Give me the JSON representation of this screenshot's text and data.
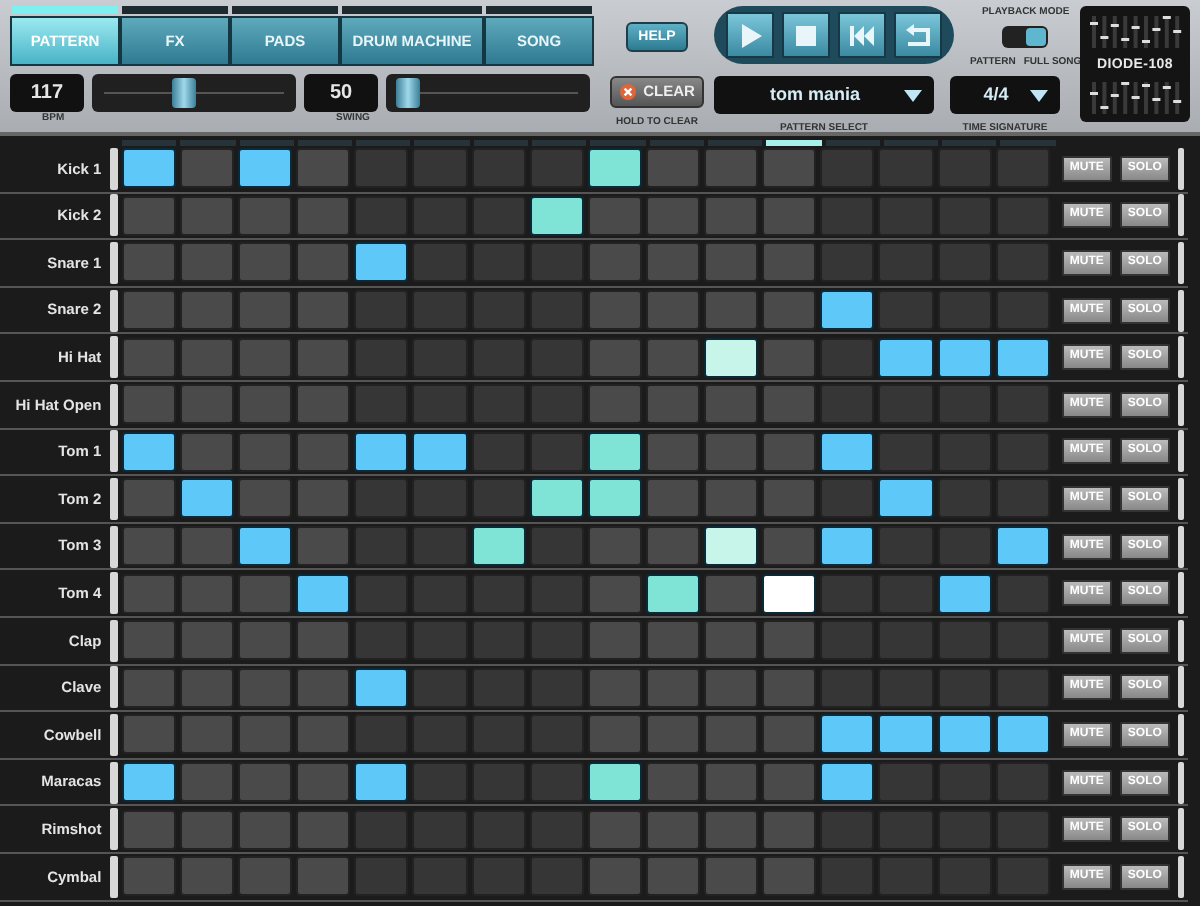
{
  "tabs": [
    {
      "label": "PATTERN",
      "selected": true
    },
    {
      "label": "FX",
      "selected": false
    },
    {
      "label": "PADS",
      "selected": false
    },
    {
      "label": "DRUM MACHINE",
      "selected": false
    },
    {
      "label": "SONG",
      "selected": false
    }
  ],
  "bpm": {
    "value": "117",
    "label": "BPM",
    "level": 0.45
  },
  "swing": {
    "value": "50",
    "label": "SWING",
    "level": 0.05
  },
  "help_button": "HELP",
  "transport": [
    {
      "kind": "play"
    },
    {
      "kind": "stop"
    },
    {
      "kind": "rewind"
    },
    {
      "kind": "loop"
    }
  ],
  "playback_mode": {
    "title": "PLAYBACK MODE",
    "left_label": "PATTERN",
    "right_label": "FULL SONG",
    "full_song": true
  },
  "clear_button": {
    "label": "CLEAR",
    "hint": "HOLD TO CLEAR"
  },
  "pattern_select": {
    "value": "tom mania",
    "label": "PATTERN SELECT"
  },
  "time_signature": {
    "value": "4/4",
    "label": "TIME SIGNATURE"
  },
  "logo": "DIODE-108",
  "step_markers": [
    {
      "current": false
    },
    {
      "current": false
    },
    {
      "current": false
    },
    {
      "current": false
    },
    {
      "current": false
    },
    {
      "current": false
    },
    {
      "current": false
    },
    {
      "current": false
    },
    {
      "current": false
    },
    {
      "current": false
    },
    {
      "current": false
    },
    {
      "current": true
    },
    {
      "current": false
    },
    {
      "current": false
    },
    {
      "current": false
    },
    {
      "current": false
    }
  ],
  "tracks": [
    {
      "name": "Kick 1",
      "mute": "MUTE",
      "solo": "SOLO",
      "muted": false,
      "soloed": false,
      "steps": [
        {
          "on": true,
          "color": "#5ec8f8"
        },
        {
          "on": false
        },
        {
          "on": true,
          "color": "#5ec8f8"
        },
        {
          "on": false
        },
        {
          "on": false
        },
        {
          "on": false
        },
        {
          "on": false
        },
        {
          "on": false
        },
        {
          "on": true,
          "color": "#7fe3d6"
        },
        {
          "on": false
        },
        {
          "on": false
        },
        {
          "on": false
        },
        {
          "on": false
        },
        {
          "on": false
        },
        {
          "on": false
        },
        {
          "on": false
        }
      ]
    },
    {
      "name": "Kick 2",
      "mute": "MUTE",
      "solo": "SOLO",
      "muted": false,
      "soloed": false,
      "steps": [
        {
          "on": false
        },
        {
          "on": false
        },
        {
          "on": false
        },
        {
          "on": false
        },
        {
          "on": false
        },
        {
          "on": false
        },
        {
          "on": false
        },
        {
          "on": true,
          "color": "#7fe3d6"
        },
        {
          "on": false
        },
        {
          "on": false
        },
        {
          "on": false
        },
        {
          "on": false
        },
        {
          "on": false
        },
        {
          "on": false
        },
        {
          "on": false
        },
        {
          "on": false
        }
      ]
    },
    {
      "name": "Snare 1",
      "mute": "MUTE",
      "solo": "SOLO",
      "muted": false,
      "soloed": false,
      "steps": [
        {
          "on": false
        },
        {
          "on": false
        },
        {
          "on": false
        },
        {
          "on": false
        },
        {
          "on": true,
          "color": "#5ec8f8"
        },
        {
          "on": false
        },
        {
          "on": false
        },
        {
          "on": false
        },
        {
          "on": false
        },
        {
          "on": false
        },
        {
          "on": false
        },
        {
          "on": false
        },
        {
          "on": false
        },
        {
          "on": false
        },
        {
          "on": false
        },
        {
          "on": false
        }
      ]
    },
    {
      "name": "Snare 2",
      "mute": "MUTE",
      "solo": "SOLO",
      "muted": false,
      "soloed": false,
      "steps": [
        {
          "on": false
        },
        {
          "on": false
        },
        {
          "on": false
        },
        {
          "on": false
        },
        {
          "on": false
        },
        {
          "on": false
        },
        {
          "on": false
        },
        {
          "on": false
        },
        {
          "on": false
        },
        {
          "on": false
        },
        {
          "on": false
        },
        {
          "on": false
        },
        {
          "on": true,
          "color": "#5ec8f8"
        },
        {
          "on": false
        },
        {
          "on": false
        },
        {
          "on": false
        }
      ]
    },
    {
      "name": "Hi Hat",
      "mute": "MUTE",
      "solo": "SOLO",
      "muted": false,
      "soloed": false,
      "steps": [
        {
          "on": false
        },
        {
          "on": false
        },
        {
          "on": false
        },
        {
          "on": false
        },
        {
          "on": false
        },
        {
          "on": false
        },
        {
          "on": false
        },
        {
          "on": false
        },
        {
          "on": false
        },
        {
          "on": false
        },
        {
          "on": true,
          "color": "#c8f5ea"
        },
        {
          "on": false
        },
        {
          "on": false
        },
        {
          "on": true,
          "color": "#5ec8f8"
        },
        {
          "on": true,
          "color": "#5ec8f8"
        },
        {
          "on": true,
          "color": "#5ec8f8"
        }
      ]
    },
    {
      "name": "Hi Hat Open",
      "mute": "MUTE",
      "solo": "SOLO",
      "muted": false,
      "soloed": false,
      "steps": [
        {
          "on": false
        },
        {
          "on": false
        },
        {
          "on": false
        },
        {
          "on": false
        },
        {
          "on": false
        },
        {
          "on": false
        },
        {
          "on": false
        },
        {
          "on": false
        },
        {
          "on": false
        },
        {
          "on": false
        },
        {
          "on": false
        },
        {
          "on": false
        },
        {
          "on": false
        },
        {
          "on": false
        },
        {
          "on": false
        },
        {
          "on": false
        }
      ]
    },
    {
      "name": "Tom 1",
      "mute": "MUTE",
      "solo": "SOLO",
      "muted": false,
      "soloed": false,
      "steps": [
        {
          "on": true,
          "color": "#5ec8f8"
        },
        {
          "on": false
        },
        {
          "on": false
        },
        {
          "on": false
        },
        {
          "on": true,
          "color": "#5ec8f8"
        },
        {
          "on": true,
          "color": "#5ec8f8"
        },
        {
          "on": false
        },
        {
          "on": false
        },
        {
          "on": true,
          "color": "#7fe3d6"
        },
        {
          "on": false
        },
        {
          "on": false
        },
        {
          "on": false
        },
        {
          "on": true,
          "color": "#5ec8f8"
        },
        {
          "on": false
        },
        {
          "on": false
        },
        {
          "on": false
        }
      ]
    },
    {
      "name": "Tom 2",
      "mute": "MUTE",
      "solo": "SOLO",
      "muted": false,
      "soloed": false,
      "steps": [
        {
          "on": false
        },
        {
          "on": true,
          "color": "#5ec8f8"
        },
        {
          "on": false
        },
        {
          "on": false
        },
        {
          "on": false
        },
        {
          "on": false
        },
        {
          "on": false
        },
        {
          "on": true,
          "color": "#7fe3d6"
        },
        {
          "on": true,
          "color": "#7fe3d6"
        },
        {
          "on": false
        },
        {
          "on": false
        },
        {
          "on": false
        },
        {
          "on": false
        },
        {
          "on": true,
          "color": "#5ec8f8"
        },
        {
          "on": false
        },
        {
          "on": false
        }
      ]
    },
    {
      "name": "Tom 3",
      "mute": "MUTE",
      "solo": "SOLO",
      "muted": false,
      "soloed": false,
      "steps": [
        {
          "on": false
        },
        {
          "on": false
        },
        {
          "on": true,
          "color": "#5ec8f8"
        },
        {
          "on": false
        },
        {
          "on": false
        },
        {
          "on": false
        },
        {
          "on": true,
          "color": "#7fe3d6"
        },
        {
          "on": false
        },
        {
          "on": false
        },
        {
          "on": false
        },
        {
          "on": true,
          "color": "#c8f5ea"
        },
        {
          "on": false
        },
        {
          "on": true,
          "color": "#5ec8f8"
        },
        {
          "on": false
        },
        {
          "on": false
        },
        {
          "on": true,
          "color": "#5ec8f8"
        }
      ]
    },
    {
      "name": "Tom 4",
      "mute": "MUTE",
      "solo": "SOLO",
      "muted": false,
      "soloed": false,
      "steps": [
        {
          "on": false
        },
        {
          "on": false
        },
        {
          "on": false
        },
        {
          "on": true,
          "color": "#5ec8f8"
        },
        {
          "on": false
        },
        {
          "on": false
        },
        {
          "on": false
        },
        {
          "on": false
        },
        {
          "on": false
        },
        {
          "on": true,
          "color": "#7fe3d6"
        },
        {
          "on": false
        },
        {
          "on": true,
          "color": "#ffffff"
        },
        {
          "on": false
        },
        {
          "on": false
        },
        {
          "on": true,
          "color": "#5ec8f8"
        },
        {
          "on": false
        }
      ]
    },
    {
      "name": "Clap",
      "mute": "MUTE",
      "solo": "SOLO",
      "muted": false,
      "soloed": false,
      "steps": [
        {
          "on": false
        },
        {
          "on": false
        },
        {
          "on": false
        },
        {
          "on": false
        },
        {
          "on": false
        },
        {
          "on": false
        },
        {
          "on": false
        },
        {
          "on": false
        },
        {
          "on": false
        },
        {
          "on": false
        },
        {
          "on": false
        },
        {
          "on": false
        },
        {
          "on": false
        },
        {
          "on": false
        },
        {
          "on": false
        },
        {
          "on": false
        }
      ]
    },
    {
      "name": "Clave",
      "mute": "MUTE",
      "solo": "SOLO",
      "muted": false,
      "soloed": false,
      "steps": [
        {
          "on": false
        },
        {
          "on": false
        },
        {
          "on": false
        },
        {
          "on": false
        },
        {
          "on": true,
          "color": "#5ec8f8"
        },
        {
          "on": false
        },
        {
          "on": false
        },
        {
          "on": false
        },
        {
          "on": false
        },
        {
          "on": false
        },
        {
          "on": false
        },
        {
          "on": false
        },
        {
          "on": false
        },
        {
          "on": false
        },
        {
          "on": false
        },
        {
          "on": false
        }
      ]
    },
    {
      "name": "Cowbell",
      "mute": "MUTE",
      "solo": "SOLO",
      "muted": false,
      "soloed": false,
      "steps": [
        {
          "on": false
        },
        {
          "on": false
        },
        {
          "on": false
        },
        {
          "on": false
        },
        {
          "on": false
        },
        {
          "on": false
        },
        {
          "on": false
        },
        {
          "on": false
        },
        {
          "on": false
        },
        {
          "on": false
        },
        {
          "on": false
        },
        {
          "on": false
        },
        {
          "on": true,
          "color": "#5ec8f8"
        },
        {
          "on": true,
          "color": "#5ec8f8"
        },
        {
          "on": true,
          "color": "#5ec8f8"
        },
        {
          "on": true,
          "color": "#5ec8f8"
        }
      ]
    },
    {
      "name": "Maracas",
      "mute": "MUTE",
      "solo": "SOLO",
      "muted": false,
      "soloed": false,
      "steps": [
        {
          "on": true,
          "color": "#5ec8f8"
        },
        {
          "on": false
        },
        {
          "on": false
        },
        {
          "on": false
        },
        {
          "on": true,
          "color": "#5ec8f8"
        },
        {
          "on": false
        },
        {
          "on": false
        },
        {
          "on": false
        },
        {
          "on": true,
          "color": "#7fe3d6"
        },
        {
          "on": false
        },
        {
          "on": false
        },
        {
          "on": false
        },
        {
          "on": true,
          "color": "#5ec8f8"
        },
        {
          "on": false
        },
        {
          "on": false
        },
        {
          "on": false
        }
      ]
    },
    {
      "name": "Rimshot",
      "mute": "MUTE",
      "solo": "SOLO",
      "muted": false,
      "soloed": false,
      "steps": [
        {
          "on": false
        },
        {
          "on": false
        },
        {
          "on": false
        },
        {
          "on": false
        },
        {
          "on": false
        },
        {
          "on": false
        },
        {
          "on": false
        },
        {
          "on": false
        },
        {
          "on": false
        },
        {
          "on": false
        },
        {
          "on": false
        },
        {
          "on": false
        },
        {
          "on": false
        },
        {
          "on": false
        },
        {
          "on": false
        },
        {
          "on": false
        }
      ]
    },
    {
      "name": "Cymbal",
      "mute": "MUTE",
      "solo": "SOLO",
      "muted": false,
      "soloed": false,
      "steps": [
        {
          "on": false
        },
        {
          "on": false
        },
        {
          "on": false
        },
        {
          "on": false
        },
        {
          "on": false
        },
        {
          "on": false
        },
        {
          "on": false
        },
        {
          "on": false
        },
        {
          "on": false
        },
        {
          "on": false
        },
        {
          "on": false
        },
        {
          "on": false
        },
        {
          "on": false
        },
        {
          "on": false
        },
        {
          "on": false
        },
        {
          "on": false
        }
      ]
    }
  ]
}
